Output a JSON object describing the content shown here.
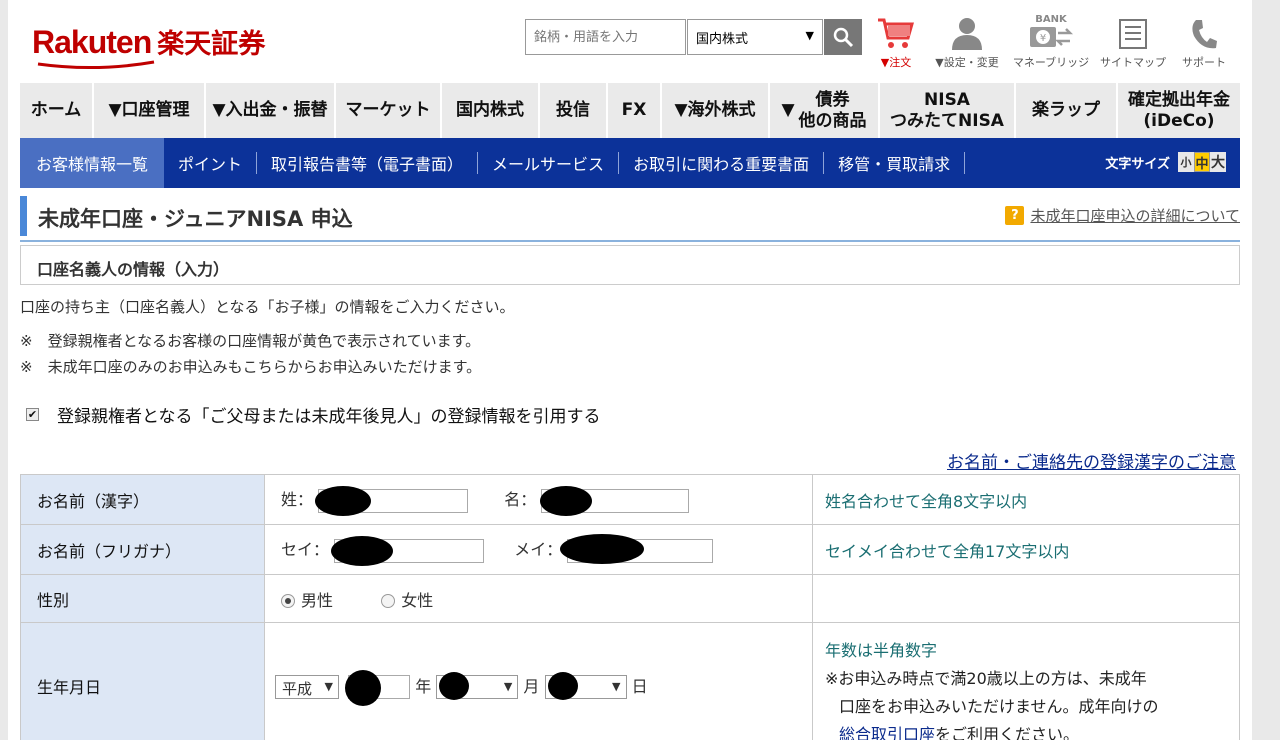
{
  "header": {
    "logo_en": "Rakuten",
    "logo_jp": "楽天証券",
    "search_placeholder": "銘柄・用語を入力",
    "search_category": "国内株式",
    "icons": [
      {
        "name": "cart-icon",
        "label": "▼注文"
      },
      {
        "name": "person-icon",
        "label": "▼設定・変更"
      },
      {
        "name": "bank-icon",
        "label": "マネーブリッジ",
        "badge": "BANK"
      },
      {
        "name": "sitemap-icon",
        "label": "サイトマップ"
      },
      {
        "name": "phone-icon",
        "label": "サポート"
      }
    ]
  },
  "mainnav": [
    {
      "label": "ホーム"
    },
    {
      "label": "▼口座管理"
    },
    {
      "label": "▼入出金・振替"
    },
    {
      "label": "マーケット"
    },
    {
      "label": "国内株式"
    },
    {
      "label": "投信"
    },
    {
      "label": "FX"
    },
    {
      "label": "▼海外株式"
    },
    {
      "label": "▼",
      "label2a": "債券",
      "label2b": "他の商品"
    },
    {
      "label": "NISA",
      "label_b": "つみたてNISA"
    },
    {
      "label": "楽ラップ"
    },
    {
      "label": "確定拠出年金",
      "label_b": "(iDeCo)"
    }
  ],
  "subnav": [
    {
      "label": "お客様情報一覧",
      "active": true
    },
    {
      "label": "ポイント"
    },
    {
      "label": "取引報告書等（電子書面）"
    },
    {
      "label": "メールサービス"
    },
    {
      "label": "お取引に関わる重要書面"
    },
    {
      "label": "移管・買取請求"
    }
  ],
  "fontsize": {
    "label": "文字サイズ",
    "small": "小",
    "medium": "中",
    "large": "大"
  },
  "page": {
    "title": "未成年口座・ジュニアNISA 申込",
    "help_link": "未成年口座申込の詳細について",
    "section_title": "口座名義人の情報（入力）",
    "intro": "口座の持ち主（口座名義人）となる「お子様」の情報をご入力ください。",
    "note1": "※　登録親権者となるお客様の口座情報が黄色で表示されています。",
    "note2": "※　未成年口座のみのお申込みもこちらからお申込みいただけます。",
    "checkbox_label": "登録親権者となる「ご父母または未成年後見人」の登録情報を引用する",
    "kanji_notice_link": "お名前・ご連絡先の登録漢字のご注意"
  },
  "form": {
    "name_kanji": {
      "label": "お名前（漢字）",
      "last": "姓：",
      "first": "名：",
      "note": "姓名合わせて全角8文字以内"
    },
    "name_kana": {
      "label": "お名前（フリガナ）",
      "last": "セイ：",
      "first": "メイ：",
      "note": "セイメイ合わせて全角17文字以内"
    },
    "gender": {
      "label": "性別",
      "male": "男性",
      "female": "女性",
      "selected": "male"
    },
    "birth": {
      "label": "生年月日",
      "era": "平成",
      "year": "年",
      "month": "月",
      "day": "日",
      "note_title": "年数は半角数字",
      "note_line1": "※お申込み時点で満20歳以上の方は、未成年",
      "note_line2": "口座をお申込みいただけません。成年向けの",
      "note_link": "総合取引口座",
      "note_tail": "をご利用ください。"
    }
  }
}
